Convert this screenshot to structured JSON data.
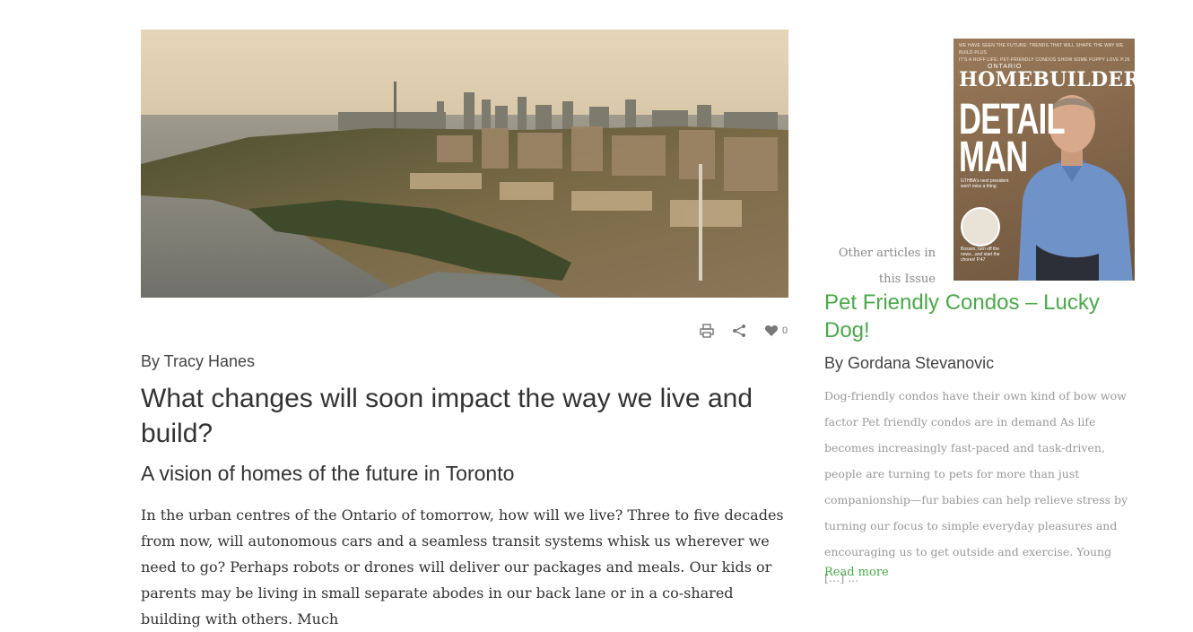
{
  "article": {
    "author": "By Tracy Hanes",
    "title": "What changes will soon impact the way we live and build?",
    "subtitle": "A vision of homes of the future in Toronto",
    "body": "In the urban centres of the Ontario of tomorrow, how will we live? Three to five decades from now, will autonomous cars and a seamless transit systems whisk us wherever we need to go? Perhaps robots or drones will deliver our packages and meals. Our kids or parents may be living in small separate abodes in our back lane or in a co-shared building with others. Much",
    "hero_image": "toronto-waterfront-aerial-rendering",
    "like_count": "0"
  },
  "actions": {
    "print_icon": "print-icon",
    "share_icon": "share-icon",
    "like_icon": "heart-icon"
  },
  "sidebar": {
    "cover": {
      "top_line1": "WE HAVE SEEN THE FUTURE: TRENDS THAT WILL SHAPE THE WAY WE BUILD PLUS",
      "top_line2": "IT'S A RUFF LIFE: PET-FRIENDLY CONDOS SHOW SOME PUPPY LOVE P.26",
      "small": "ONTARIO",
      "brand": "HOMEBUILDER",
      "headline_line1": "DETAIL",
      "headline_line2": "MAN",
      "blurb": "GTHBA's next president won't miss a thing.",
      "circle_caption": "Bosses, turn off the news...and start the chores! P.47"
    },
    "other_label_line1": "Other articles in",
    "other_label_line2": "this Issue",
    "related_title": "Pet Friendly Condos – Lucky Dog!",
    "related_author": "By Gordana Stevanovic",
    "related_excerpt": "Dog-friendly condos have their own kind of bow wow factor Pet friendly condos are in demand As life becomes increasingly fast-paced and task-driven, people are turning to pets for more than just companionship—fur babies can help relieve stress by turning our focus to simple everyday pleasures and encouraging us to get outside and exercise. Young […] ...",
    "read_more": "Read more"
  },
  "colors": {
    "accent_green": "#4ba84a",
    "text_dark": "#333333",
    "text_muted": "#999999"
  }
}
